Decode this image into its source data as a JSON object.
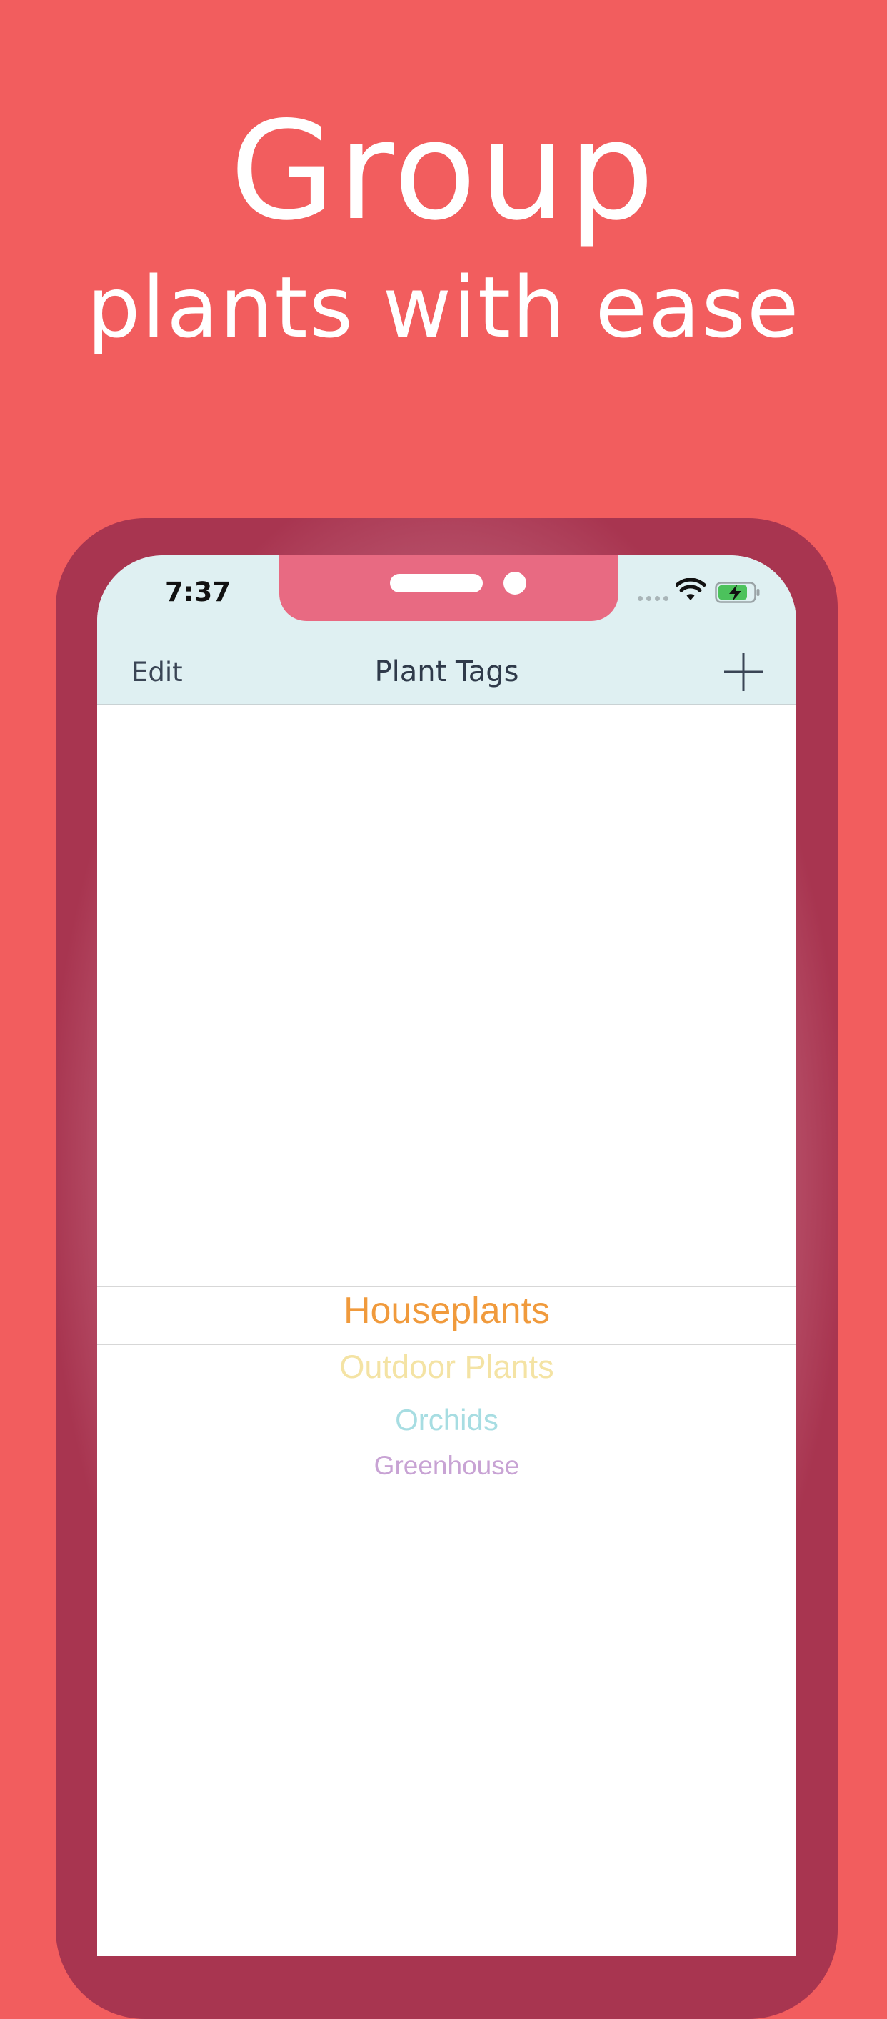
{
  "headline": {
    "line1": "Group",
    "line2": "plants with ease"
  },
  "status_bar": {
    "time": "7:37"
  },
  "nav_bar": {
    "edit_label": "Edit",
    "title": "Plant Tags",
    "add_icon": "plus-icon"
  },
  "picker": {
    "items": [
      {
        "label": "Houseplants",
        "color": "#F09A3C",
        "selected": true
      },
      {
        "label": "Outdoor Plants",
        "color": "#F4E3A4",
        "selected": false
      },
      {
        "label": "Orchids",
        "color": "#A7DDE2",
        "selected": false
      },
      {
        "label": "Greenhouse",
        "color": "#C8A3D4",
        "selected": false
      }
    ]
  },
  "colors": {
    "background": "#F25D5E",
    "phone_frame": "#A83550",
    "nav_bar": "#DFF0F2",
    "notch": "#E86A82"
  }
}
